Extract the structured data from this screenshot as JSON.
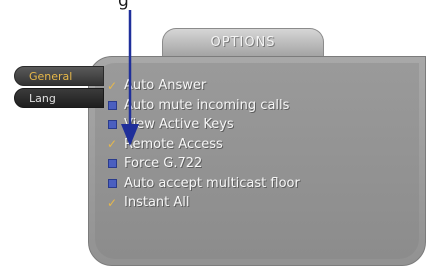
{
  "callout": {
    "label": "g"
  },
  "header": {
    "title": "OPTIONS"
  },
  "side_tabs": [
    {
      "label": "General",
      "active": true
    },
    {
      "label": "Lang",
      "active": false
    }
  ],
  "options": [
    {
      "label": "Auto Answer",
      "state": "checked"
    },
    {
      "label": "Auto mute incoming calls",
      "state": "unchecked"
    },
    {
      "label": "View Active Keys",
      "state": "unchecked"
    },
    {
      "label": "Remote Access",
      "state": "checked"
    },
    {
      "label": "Force G.722",
      "state": "unchecked"
    },
    {
      "label": "Auto accept multicast floor",
      "state": "unchecked"
    },
    {
      "label": "Instant All",
      "state": "checked"
    }
  ],
  "colors": {
    "check_mark": "#e7b84a",
    "box_mark": "#4a5fc0",
    "arrow": "#1f2f9a",
    "active_tab_text": "#e7b84a"
  },
  "icons": {
    "checked": "check-icon",
    "unchecked": "blue-square-icon",
    "pointer": "down-arrow-icon"
  }
}
